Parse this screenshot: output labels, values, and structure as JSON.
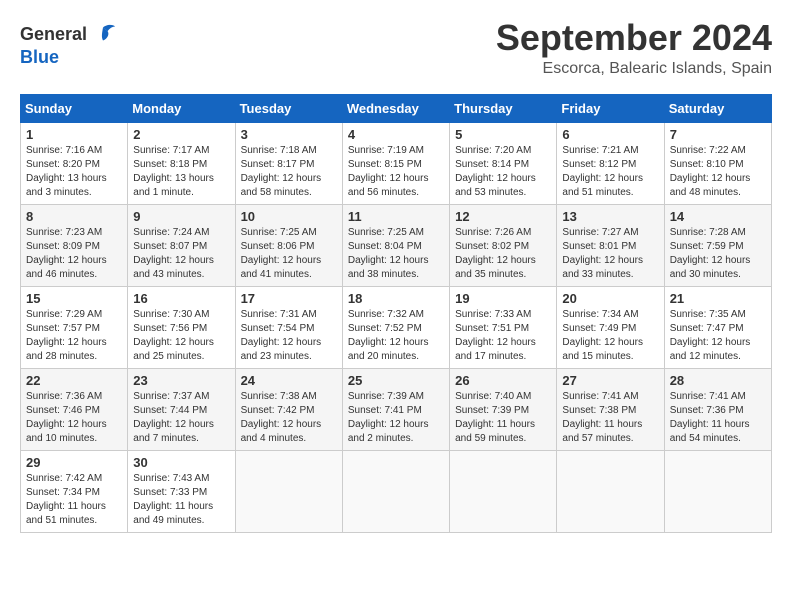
{
  "logo": {
    "text_general": "General",
    "text_blue": "Blue"
  },
  "header": {
    "month_year": "September 2024",
    "location": "Escorca, Balearic Islands, Spain"
  },
  "weekdays": [
    "Sunday",
    "Monday",
    "Tuesday",
    "Wednesday",
    "Thursday",
    "Friday",
    "Saturday"
  ],
  "weeks": [
    [
      {
        "day": "1",
        "sunrise": "Sunrise: 7:16 AM",
        "sunset": "Sunset: 8:20 PM",
        "daylight": "Daylight: 13 hours and 3 minutes."
      },
      {
        "day": "2",
        "sunrise": "Sunrise: 7:17 AM",
        "sunset": "Sunset: 8:18 PM",
        "daylight": "Daylight: 13 hours and 1 minute."
      },
      {
        "day": "3",
        "sunrise": "Sunrise: 7:18 AM",
        "sunset": "Sunset: 8:17 PM",
        "daylight": "Daylight: 12 hours and 58 minutes."
      },
      {
        "day": "4",
        "sunrise": "Sunrise: 7:19 AM",
        "sunset": "Sunset: 8:15 PM",
        "daylight": "Daylight: 12 hours and 56 minutes."
      },
      {
        "day": "5",
        "sunrise": "Sunrise: 7:20 AM",
        "sunset": "Sunset: 8:14 PM",
        "daylight": "Daylight: 12 hours and 53 minutes."
      },
      {
        "day": "6",
        "sunrise": "Sunrise: 7:21 AM",
        "sunset": "Sunset: 8:12 PM",
        "daylight": "Daylight: 12 hours and 51 minutes."
      },
      {
        "day": "7",
        "sunrise": "Sunrise: 7:22 AM",
        "sunset": "Sunset: 8:10 PM",
        "daylight": "Daylight: 12 hours and 48 minutes."
      }
    ],
    [
      {
        "day": "8",
        "sunrise": "Sunrise: 7:23 AM",
        "sunset": "Sunset: 8:09 PM",
        "daylight": "Daylight: 12 hours and 46 minutes."
      },
      {
        "day": "9",
        "sunrise": "Sunrise: 7:24 AM",
        "sunset": "Sunset: 8:07 PM",
        "daylight": "Daylight: 12 hours and 43 minutes."
      },
      {
        "day": "10",
        "sunrise": "Sunrise: 7:25 AM",
        "sunset": "Sunset: 8:06 PM",
        "daylight": "Daylight: 12 hours and 41 minutes."
      },
      {
        "day": "11",
        "sunrise": "Sunrise: 7:25 AM",
        "sunset": "Sunset: 8:04 PM",
        "daylight": "Daylight: 12 hours and 38 minutes."
      },
      {
        "day": "12",
        "sunrise": "Sunrise: 7:26 AM",
        "sunset": "Sunset: 8:02 PM",
        "daylight": "Daylight: 12 hours and 35 minutes."
      },
      {
        "day": "13",
        "sunrise": "Sunrise: 7:27 AM",
        "sunset": "Sunset: 8:01 PM",
        "daylight": "Daylight: 12 hours and 33 minutes."
      },
      {
        "day": "14",
        "sunrise": "Sunrise: 7:28 AM",
        "sunset": "Sunset: 7:59 PM",
        "daylight": "Daylight: 12 hours and 30 minutes."
      }
    ],
    [
      {
        "day": "15",
        "sunrise": "Sunrise: 7:29 AM",
        "sunset": "Sunset: 7:57 PM",
        "daylight": "Daylight: 12 hours and 28 minutes."
      },
      {
        "day": "16",
        "sunrise": "Sunrise: 7:30 AM",
        "sunset": "Sunset: 7:56 PM",
        "daylight": "Daylight: 12 hours and 25 minutes."
      },
      {
        "day": "17",
        "sunrise": "Sunrise: 7:31 AM",
        "sunset": "Sunset: 7:54 PM",
        "daylight": "Daylight: 12 hours and 23 minutes."
      },
      {
        "day": "18",
        "sunrise": "Sunrise: 7:32 AM",
        "sunset": "Sunset: 7:52 PM",
        "daylight": "Daylight: 12 hours and 20 minutes."
      },
      {
        "day": "19",
        "sunrise": "Sunrise: 7:33 AM",
        "sunset": "Sunset: 7:51 PM",
        "daylight": "Daylight: 12 hours and 17 minutes."
      },
      {
        "day": "20",
        "sunrise": "Sunrise: 7:34 AM",
        "sunset": "Sunset: 7:49 PM",
        "daylight": "Daylight: 12 hours and 15 minutes."
      },
      {
        "day": "21",
        "sunrise": "Sunrise: 7:35 AM",
        "sunset": "Sunset: 7:47 PM",
        "daylight": "Daylight: 12 hours and 12 minutes."
      }
    ],
    [
      {
        "day": "22",
        "sunrise": "Sunrise: 7:36 AM",
        "sunset": "Sunset: 7:46 PM",
        "daylight": "Daylight: 12 hours and 10 minutes."
      },
      {
        "day": "23",
        "sunrise": "Sunrise: 7:37 AM",
        "sunset": "Sunset: 7:44 PM",
        "daylight": "Daylight: 12 hours and 7 minutes."
      },
      {
        "day": "24",
        "sunrise": "Sunrise: 7:38 AM",
        "sunset": "Sunset: 7:42 PM",
        "daylight": "Daylight: 12 hours and 4 minutes."
      },
      {
        "day": "25",
        "sunrise": "Sunrise: 7:39 AM",
        "sunset": "Sunset: 7:41 PM",
        "daylight": "Daylight: 12 hours and 2 minutes."
      },
      {
        "day": "26",
        "sunrise": "Sunrise: 7:40 AM",
        "sunset": "Sunset: 7:39 PM",
        "daylight": "Daylight: 11 hours and 59 minutes."
      },
      {
        "day": "27",
        "sunrise": "Sunrise: 7:41 AM",
        "sunset": "Sunset: 7:38 PM",
        "daylight": "Daylight: 11 hours and 57 minutes."
      },
      {
        "day": "28",
        "sunrise": "Sunrise: 7:41 AM",
        "sunset": "Sunset: 7:36 PM",
        "daylight": "Daylight: 11 hours and 54 minutes."
      }
    ],
    [
      {
        "day": "29",
        "sunrise": "Sunrise: 7:42 AM",
        "sunset": "Sunset: 7:34 PM",
        "daylight": "Daylight: 11 hours and 51 minutes."
      },
      {
        "day": "30",
        "sunrise": "Sunrise: 7:43 AM",
        "sunset": "Sunset: 7:33 PM",
        "daylight": "Daylight: 11 hours and 49 minutes."
      },
      null,
      null,
      null,
      null,
      null
    ]
  ]
}
